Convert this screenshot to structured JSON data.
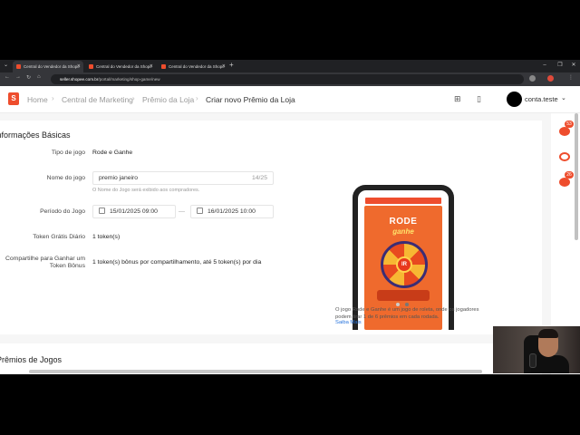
{
  "browser": {
    "tabs": [
      {
        "title": "Central do Vendedor da Shope",
        "active": true
      },
      {
        "title": "Central do Vendedor da Shope",
        "active": false
      },
      {
        "title": "Central do Vendedor da Shope",
        "active": false
      }
    ],
    "new_tab": "+",
    "url_site": "seller.shopee.com.br",
    "url_path": "/portal/marketing/shop-game/new"
  },
  "header": {
    "logo": "S",
    "breadcrumbs": [
      "Home",
      "Central de Marketing",
      "Prêmio da Loja",
      "Criar novo Prêmio da Loja"
    ],
    "separator": "›",
    "username": "conta.teste"
  },
  "basic_info": {
    "title": "Informações Básicas",
    "fields": {
      "game_type": {
        "label": "Tipo de jogo",
        "value": "Rode e Ganhe"
      },
      "game_name": {
        "label": "Nome do jogo",
        "value": "premio janeiro",
        "counter": "14/25",
        "hint": "O Nome do Jogo será exibido aos compradores."
      },
      "period": {
        "label": "Período do Jogo",
        "start": "15/01/2025 09:00",
        "end": "16/01/2025 10:00",
        "separator": "—"
      },
      "daily_tokens": {
        "label": "Token Grátis Diário",
        "value": "1 token(s)"
      },
      "share_tokens": {
        "label": "Compartilhe para Ganhar um Token Bônus",
        "value": "1 token(s) bônus por compartilhamento, até 5 token(s) por dia"
      }
    }
  },
  "preview": {
    "game_title": "RODE",
    "game_subtitle": "ganhe",
    "spin_label": "IR",
    "description": "O jogo Rode e Ganhe é um jogo de roleta, onde os jogadores podem tirar 1 de 6 prêmios em cada rodada.",
    "link": "Saiba Mais"
  },
  "prizes": {
    "title": "Prêmios de Jogos"
  },
  "rail": {
    "badges": [
      "53",
      "26"
    ]
  }
}
